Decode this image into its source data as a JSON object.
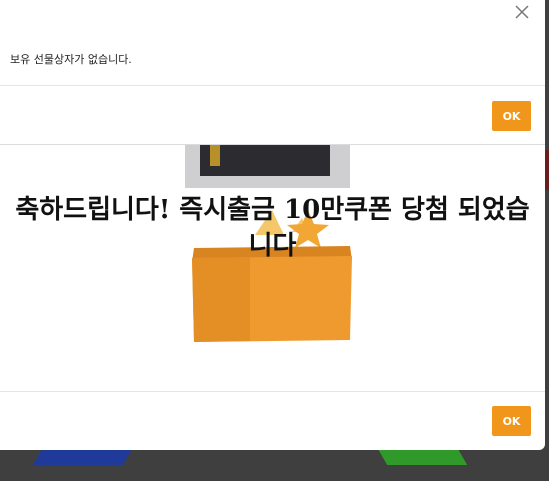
{
  "notice_dialog": {
    "message": "보유 선물상자가 없습니다.",
    "ok_label": "OK",
    "close_icon": "close-icon"
  },
  "prize_dialog": {
    "congrats_text": "축하드립니다! 즉시출금 10만쿠폰 당첨 되었습니다",
    "ok_label": "OK",
    "art_icon": "gift-box-icon"
  },
  "colors": {
    "accent": "#f0961a",
    "box_orange": "#ee9a2e",
    "overlay": "#3f3f3f"
  }
}
